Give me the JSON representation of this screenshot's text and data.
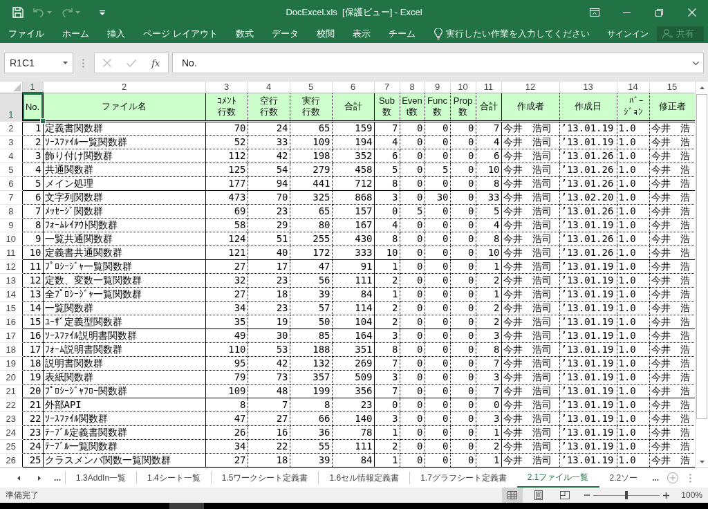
{
  "title_bar": {
    "quick_access": [
      {
        "kind": "save",
        "disabled": false
      },
      {
        "kind": "undo",
        "disabled": true
      },
      {
        "kind": "redo",
        "disabled": true
      },
      {
        "kind": "customize",
        "disabled": false
      }
    ],
    "title": "DocExcel.xls  [保護ビュー] - Excel"
  },
  "ribbon": {
    "tabs": [
      "ファイル",
      "ホーム",
      "挿入",
      "ページ レイアウト",
      "数式",
      "データ",
      "校閲",
      "表示",
      "チーム"
    ],
    "tell_me": {
      "placeholder": "実行したい作業を入力してください"
    },
    "sign_in": "サインイン",
    "share": {
      "label": "共有",
      "disabled": true
    }
  },
  "formula_bar": {
    "name_box": "R1C1",
    "buttons": [
      {
        "kind": "cancel",
        "disabled": true
      },
      {
        "kind": "enter",
        "disabled": true
      }
    ],
    "insert_function": "fx",
    "value": "No."
  },
  "sheet": {
    "columns": [
      {
        "label": "1",
        "selected": true
      },
      {
        "label": "2",
        "selected": false
      },
      {
        "label": "3",
        "selected": false
      },
      {
        "label": "4",
        "selected": false
      },
      {
        "label": "5",
        "selected": false
      },
      {
        "label": "6",
        "selected": false
      },
      {
        "label": "7",
        "selected": false
      },
      {
        "label": "8",
        "selected": false
      },
      {
        "label": "9",
        "selected": false
      },
      {
        "label": "10",
        "selected": false
      },
      {
        "label": "11",
        "selected": false
      },
      {
        "label": "12",
        "selected": false
      },
      {
        "label": "13",
        "selected": false
      },
      {
        "label": "14",
        "selected": false
      },
      {
        "label": "15",
        "selected": false
      }
    ],
    "header": {
      "row_label": "1",
      "selected": true,
      "cells": [
        "No.",
        "ファイル名",
        "ｺﾒﾝﾄ行数",
        "空行行数",
        "実行行数",
        "合計",
        "Sub数",
        "Event数",
        "Func数",
        "Prop数",
        "合計",
        "作成者",
        "作成日",
        "ﾊﾞｰｼﾞｮﾝ",
        "修正者"
      ]
    },
    "rows": [
      {
        "row_label": "2",
        "selected": false,
        "cells": [
          "1",
          "定義書関数群",
          "70",
          "24",
          "65",
          "159",
          "7",
          "0",
          "0",
          "0",
          "7",
          "今井　浩司",
          "’13.01.19",
          "1.0",
          "今井　浩"
        ]
      },
      {
        "row_label": "3",
        "selected": false,
        "cells": [
          "2",
          "ｿｰｽﾌｧｲﾙ一覧関数群",
          "52",
          "33",
          "109",
          "194",
          "4",
          "0",
          "0",
          "0",
          "4",
          "今井　浩司",
          "’13.01.19",
          "1.0",
          "今井　浩"
        ]
      },
      {
        "row_label": "4",
        "selected": false,
        "cells": [
          "3",
          "飾り付け関数群",
          "112",
          "42",
          "198",
          "352",
          "6",
          "0",
          "0",
          "0",
          "6",
          "今井　浩司",
          "’13.01.26",
          "1.0",
          "今井　浩"
        ]
      },
      {
        "row_label": "5",
        "selected": false,
        "cells": [
          "4",
          "共通関数群",
          "125",
          "54",
          "279",
          "458",
          "5",
          "0",
          "5",
          "0",
          "10",
          "今井　浩司",
          "’13.01.26",
          "1.0",
          "今井　浩"
        ]
      },
      {
        "row_label": "6",
        "selected": false,
        "cells": [
          "5",
          "メイン処理",
          "177",
          "94",
          "441",
          "712",
          "8",
          "0",
          "0",
          "0",
          "8",
          "今井　浩司",
          "’13.01.26",
          "1.0",
          "今井　浩"
        ]
      },
      {
        "row_label": "7",
        "selected": false,
        "cells": [
          "6",
          "文字列関数群",
          "473",
          "70",
          "325",
          "868",
          "3",
          "0",
          "30",
          "0",
          "33",
          "今井　浩司",
          "’13.02.20",
          "1.0",
          "今井　浩"
        ]
      },
      {
        "row_label": "8",
        "selected": false,
        "cells": [
          "7",
          "ﾒｯｾｰｼﾞ関数群",
          "69",
          "23",
          "65",
          "157",
          "0",
          "5",
          "0",
          "0",
          "5",
          "今井　浩司",
          "’13.01.26",
          "1.0",
          "今井　浩"
        ]
      },
      {
        "row_label": "9",
        "selected": false,
        "cells": [
          "8",
          "ﾌｫｰﾑﾚｲｱｳﾄ関数群",
          "58",
          "29",
          "80",
          "167",
          "4",
          "0",
          "0",
          "0",
          "4",
          "今井　浩司",
          "’13.01.19",
          "1.0",
          "今井　浩"
        ]
      },
      {
        "row_label": "10",
        "selected": false,
        "cells": [
          "9",
          "一覧共通関数群",
          "124",
          "51",
          "255",
          "430",
          "8",
          "0",
          "0",
          "0",
          "8",
          "今井　浩司",
          "’13.01.26",
          "1.0",
          "今井　浩"
        ]
      },
      {
        "row_label": "11",
        "selected": false,
        "cells": [
          "10",
          "定義書共通関数群",
          "121",
          "40",
          "172",
          "333",
          "10",
          "0",
          "0",
          "0",
          "10",
          "今井　浩司",
          "’13.01.26",
          "1.0",
          "今井　浩"
        ]
      },
      {
        "row_label": "12",
        "selected": false,
        "cells": [
          "11",
          "ﾌﾟﾛｼｰｼﾞｬ一覧関数群",
          "27",
          "17",
          "47",
          "91",
          "1",
          "0",
          "0",
          "0",
          "1",
          "今井　浩司",
          "’13.01.19",
          "1.0",
          "今井　浩"
        ]
      },
      {
        "row_label": "13",
        "selected": false,
        "cells": [
          "12",
          "定数、変数一覧関数群",
          "32",
          "23",
          "56",
          "111",
          "2",
          "0",
          "0",
          "0",
          "2",
          "今井　浩司",
          "’13.01.19",
          "1.0",
          "今井　浩"
        ]
      },
      {
        "row_label": "14",
        "selected": false,
        "cells": [
          "13",
          "全ﾌﾟﾛｼｰｼﾞｬ一覧関数群",
          "27",
          "18",
          "39",
          "84",
          "1",
          "0",
          "0",
          "0",
          "1",
          "今井　浩司",
          "’13.01.19",
          "1.0",
          "今井　浩"
        ]
      },
      {
        "row_label": "15",
        "selected": false,
        "cells": [
          "14",
          "一覧関数群",
          "34",
          "23",
          "57",
          "114",
          "2",
          "0",
          "0",
          "0",
          "2",
          "今井　浩司",
          "’13.01.19",
          "1.0",
          "今井　浩"
        ]
      },
      {
        "row_label": "16",
        "selected": false,
        "cells": [
          "15",
          "ﾕｰｻﾞ定義型関数群",
          "35",
          "19",
          "50",
          "104",
          "2",
          "0",
          "0",
          "0",
          "2",
          "今井　浩司",
          "’13.01.19",
          "1.0",
          "今井　浩"
        ]
      },
      {
        "row_label": "17",
        "selected": false,
        "cells": [
          "16",
          "ｿｰｽﾌｧｲﾙ説明書関数群",
          "49",
          "30",
          "85",
          "164",
          "3",
          "0",
          "0",
          "0",
          "3",
          "今井　浩司",
          "’13.01.19",
          "1.0",
          "今井　浩"
        ]
      },
      {
        "row_label": "18",
        "selected": false,
        "cells": [
          "17",
          "ﾌｫｰﾑ説明書関数群",
          "110",
          "53",
          "188",
          "351",
          "8",
          "0",
          "0",
          "0",
          "8",
          "今井　浩司",
          "’13.01.19",
          "1.0",
          "今井　浩"
        ]
      },
      {
        "row_label": "19",
        "selected": false,
        "cells": [
          "18",
          "説明書関数群",
          "95",
          "42",
          "132",
          "269",
          "7",
          "0",
          "0",
          "0",
          "7",
          "今井　浩司",
          "’13.01.19",
          "1.0",
          "今井　浩"
        ]
      },
      {
        "row_label": "20",
        "selected": false,
        "cells": [
          "19",
          "表紙関数群",
          "79",
          "73",
          "357",
          "509",
          "3",
          "0",
          "0",
          "0",
          "3",
          "今井　浩司",
          "’13.01.19",
          "1.0",
          "今井　浩"
        ]
      },
      {
        "row_label": "21",
        "selected": false,
        "cells": [
          "20",
          "ﾌﾟﾛｼｰｼﾞｬﾌﾛｰ関数群",
          "109",
          "48",
          "199",
          "356",
          "7",
          "0",
          "0",
          "0",
          "7",
          "今井　浩司",
          "’13.01.19",
          "1.0",
          "今井　浩"
        ]
      },
      {
        "row_label": "22",
        "selected": false,
        "cells": [
          "21",
          "外部API",
          "8",
          "7",
          "8",
          "23",
          "0",
          "0",
          "0",
          "0",
          "0",
          "今井　浩司",
          "’13.01.19",
          "1.0",
          "今井　浩"
        ]
      },
      {
        "row_label": "23",
        "selected": false,
        "cells": [
          "22",
          "ｿｰｽﾌｧｲﾙ関数群",
          "47",
          "27",
          "66",
          "140",
          "3",
          "0",
          "0",
          "0",
          "3",
          "今井　浩司",
          "’13.01.19",
          "1.0",
          "今井　浩"
        ]
      },
      {
        "row_label": "24",
        "selected": false,
        "cells": [
          "23",
          "ﾃｰﾌﾞﾙ定義書関数群",
          "26",
          "16",
          "36",
          "78",
          "1",
          "0",
          "0",
          "0",
          "1",
          "今井　浩司",
          "’13.01.19",
          "1.0",
          "今井　浩"
        ]
      },
      {
        "row_label": "25",
        "selected": false,
        "cells": [
          "24",
          "ﾃｰﾌﾞﾙ一覧関数群",
          "34",
          "22",
          "55",
          "111",
          "2",
          "0",
          "0",
          "0",
          "2",
          "今井　浩司",
          "’13.01.19",
          "1.0",
          "今井　浩"
        ]
      },
      {
        "row_label": "26",
        "selected": false,
        "cells": [
          "25",
          "クラスメンバ関数一覧関数群",
          "27",
          "18",
          "39",
          "84",
          "1",
          "0",
          "0",
          "0",
          "1",
          "今井　浩司",
          "’13.01.19",
          "1.0",
          "今井　浩"
        ]
      }
    ]
  },
  "sheet_tabs": {
    "more_left": "...",
    "tabs": [
      {
        "label": "1.3AddIn一覧",
        "selected": false
      },
      {
        "label": "1.4シート一覧",
        "selected": false
      },
      {
        "label": "1.5ワークシート定義書",
        "selected": false
      },
      {
        "label": "1.6セル情報定義書",
        "selected": false
      },
      {
        "label": "1.7グラフシート定義書",
        "selected": false
      },
      {
        "label": "2.1ファイル一覧",
        "selected": true
      },
      {
        "label": "2.2ソー",
        "selected": false
      }
    ],
    "more_right": "..."
  },
  "status_bar": {
    "status": "準備完了",
    "views": [
      {
        "kind": "normal",
        "selected": true
      },
      {
        "kind": "page_layout",
        "selected": false
      },
      {
        "kind": "page_break",
        "selected": false
      }
    ],
    "zoom": {
      "level": 0.5,
      "reading": "100%"
    }
  }
}
